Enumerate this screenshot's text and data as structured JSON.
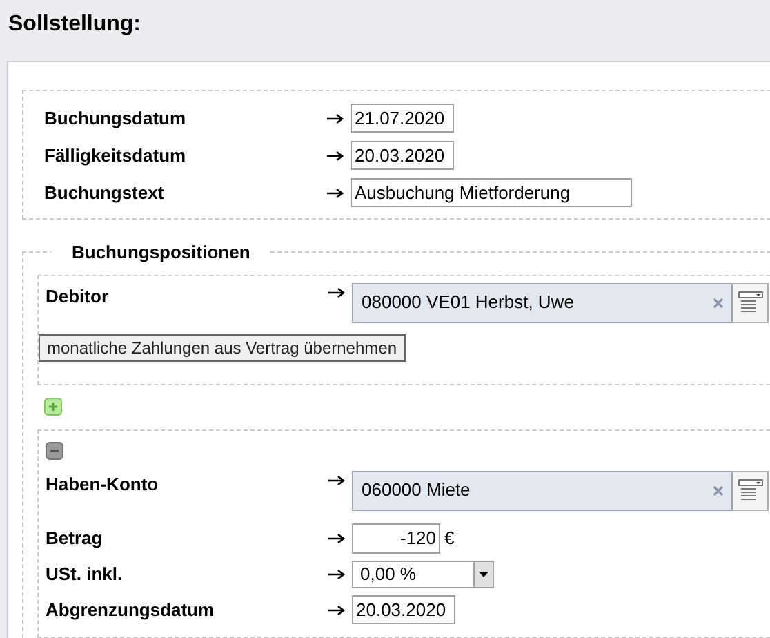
{
  "title": "Sollstellung:",
  "header_fields": [
    {
      "label": "Buchungsdatum",
      "kind": "date",
      "value": "21.07.2020"
    },
    {
      "label": "Fälligkeitsdatum",
      "kind": "date",
      "value": "20.03.2020"
    },
    {
      "label": "Buchungstext",
      "kind": "text",
      "value": "Ausbuchung Mietforderung"
    }
  ],
  "positions": {
    "legend": "Buchungspositionen",
    "debitor": {
      "label": "Debitor",
      "kind": "lookup",
      "value": "080000 VE01 Herbst, Uwe"
    },
    "import_button": "monatliche Zahlungen aus Vertrag übernehmen",
    "items": [
      {
        "fields": [
          {
            "label": "Haben-Konto",
            "kind": "lookup",
            "value": "060000 Miete"
          },
          {
            "label": "Betrag",
            "kind": "amount",
            "value": "-120",
            "unit": "€"
          },
          {
            "label": "USt. inkl.",
            "kind": "select",
            "value": "0,00 %"
          },
          {
            "label": "Abgrenzungsdatum",
            "kind": "date",
            "value": "20.03.2020"
          }
        ]
      }
    ]
  }
}
